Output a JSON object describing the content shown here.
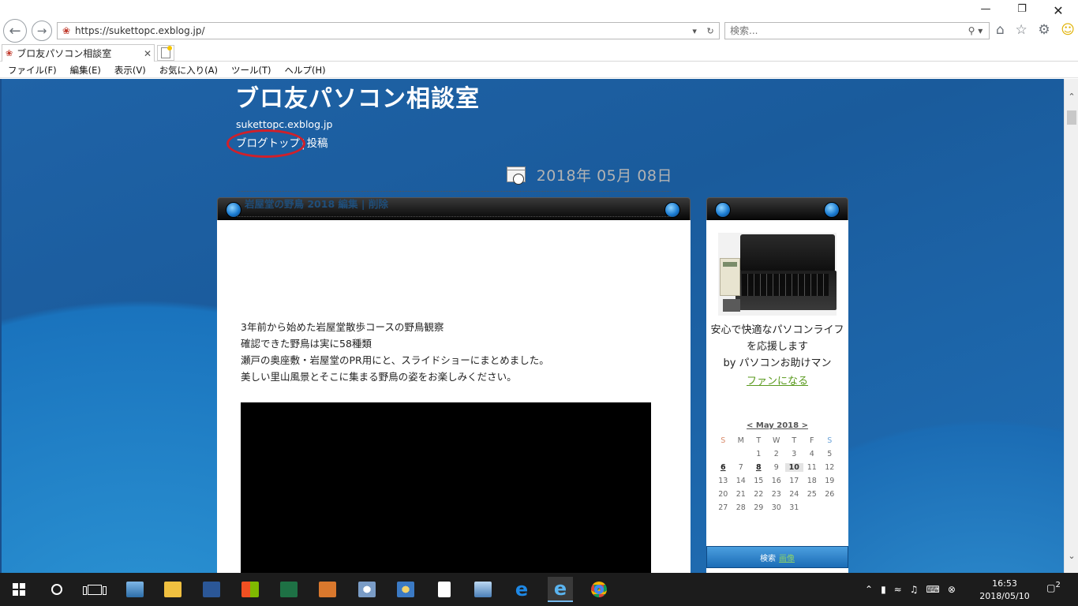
{
  "browser": {
    "url": "https://sukettopc.exblog.jp/",
    "search_placeholder": "検索...",
    "tab_title": "ブロ友パソコン相談室",
    "menu": [
      "ファイル(F)",
      "編集(E)",
      "表示(V)",
      "お気に入り(A)",
      "ツール(T)",
      "ヘルプ(H)"
    ]
  },
  "site": {
    "title": "ブロ友パソコン相談室",
    "domain": "sukettopc.exblog.jp",
    "nav_top": "ブログトップ",
    "nav_sep": "|",
    "nav_post": "投稿"
  },
  "post": {
    "date": "2018年 05月 08日",
    "title": "岩屋堂の野鳥 2018",
    "edit": "編集",
    "sep": "|",
    "delete": "削除",
    "lines": [
      "3年前から始めた岩屋堂散歩コースの野鳥観察",
      "確認できた野鳥は実に58種類",
      "瀬戸の奥座敷・岩屋堂のPR用にと、スライドショーにまとめました。",
      "美しい里山風景とそこに集まる野鳥の姿をお楽しみください。"
    ]
  },
  "sidebar": {
    "profile_line1": "安心で快適なパソコンライフ",
    "profile_line2": "を応援します",
    "profile_line3": "by パソコンお助けマン",
    "fan_link": "ファンになる",
    "calendar_title": "< May 2018 >",
    "weekdays": [
      "S",
      "M",
      "T",
      "W",
      "T",
      "F",
      "S"
    ],
    "weeks": [
      [
        "",
        "",
        "1",
        "2",
        "3",
        "4",
        "5"
      ],
      [
        "6",
        "7",
        "8",
        "9",
        "10",
        "11",
        "12"
      ],
      [
        "13",
        "14",
        "15",
        "16",
        "17",
        "18",
        "19"
      ],
      [
        "20",
        "21",
        "22",
        "23",
        "24",
        "25",
        "26"
      ],
      [
        "27",
        "28",
        "29",
        "30",
        "31",
        "",
        ""
      ]
    ],
    "search_label": "検索",
    "search_go": "画像"
  },
  "taskbar": {
    "time": "16:53",
    "date": "2018/05/10",
    "notifications": "2"
  }
}
